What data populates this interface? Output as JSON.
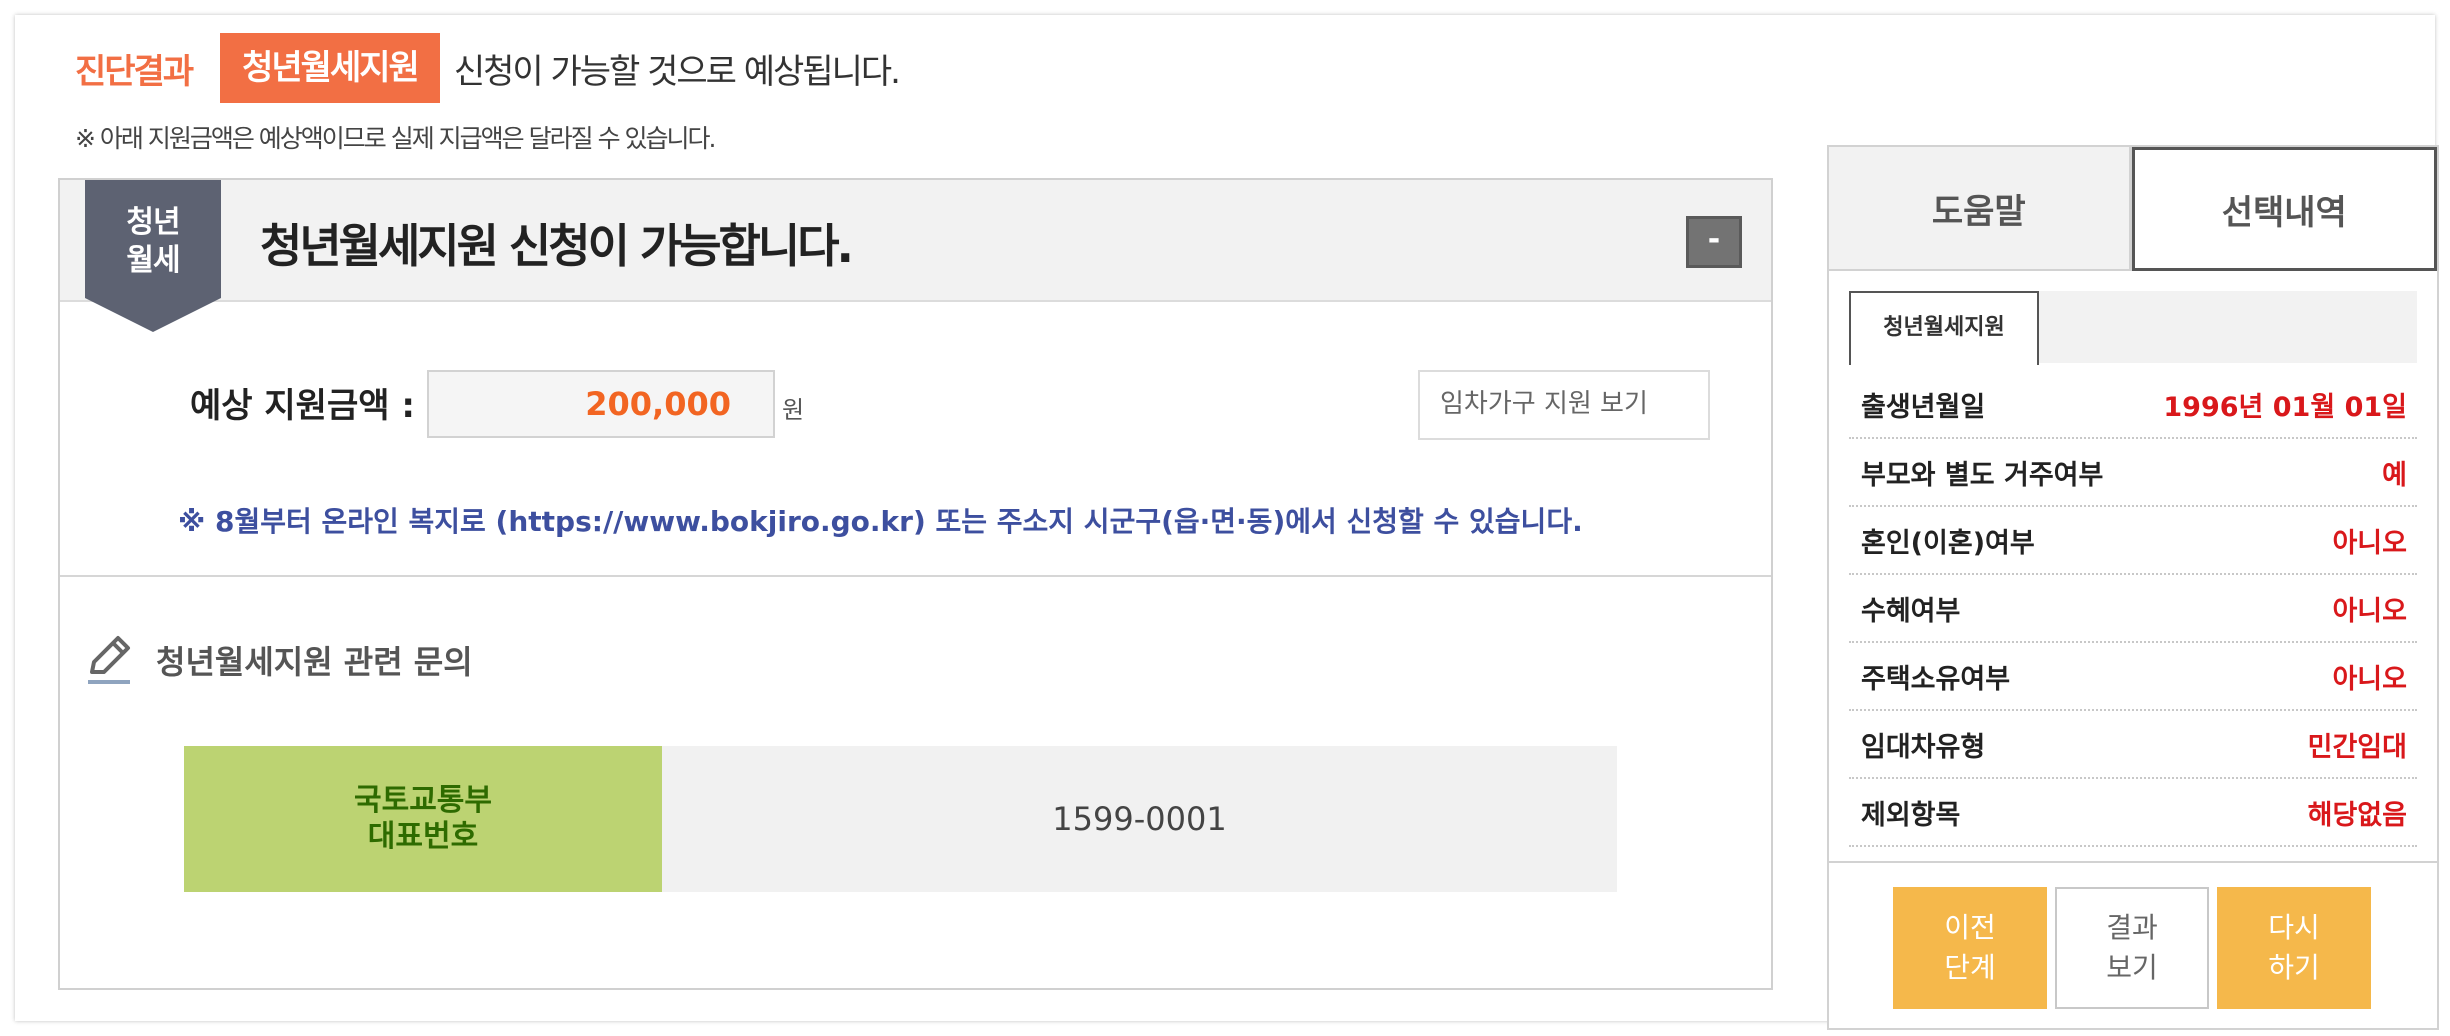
{
  "header": {
    "label": "진단결과",
    "badge": "청년월세지원",
    "text": "신청이 가능할 것으로 예상됩니다.",
    "notice": "※ 아래 지원금액은 예상액이므로 실제 지급액은 달라질 수 있습니다."
  },
  "main": {
    "ribbon_line1": "청년",
    "ribbon_line2": "월세",
    "title": "청년월세지원 신청이 가능합니다.",
    "collapse_label": "-",
    "amount_label": "예상 지원금액 :",
    "amount_value": "200,000",
    "amount_unit": "원",
    "rental_button": "임차가구 지원 보기",
    "apply_note": "※ 8월부터 온라인 복지로 (https://www.bokjiro.go.kr) 또는 주소지 시군구(읍·면·동)에서 신청할 수 있습니다.",
    "inquiry_title": "청년월세지원 관련 문의",
    "contact_label_line1": "국토교통부",
    "contact_label_line2": "대표번호",
    "contact_value": "1599-0001"
  },
  "sidebar": {
    "tabs": [
      {
        "label": "도움말"
      },
      {
        "label": "선택내역"
      }
    ],
    "active_tab": "선택내역",
    "sub_tab": "청년월세지원",
    "rows": [
      {
        "key": "출생년월일",
        "value": "1996년 01월 01일"
      },
      {
        "key": "부모와 별도 거주여부",
        "value": "예"
      },
      {
        "key": "혼인(이혼)여부",
        "value": "아니오"
      },
      {
        "key": "수혜여부",
        "value": "아니오"
      },
      {
        "key": "주택소유여부",
        "value": "아니오"
      },
      {
        "key": "임대차유형",
        "value": "민간임대"
      },
      {
        "key": "제외항목",
        "value": "해당없음"
      }
    ],
    "buttons": [
      {
        "line1": "이전",
        "line2": "단계"
      },
      {
        "line1": "결과",
        "line2": "보기"
      },
      {
        "line1": "다시",
        "line2": "하기"
      }
    ]
  },
  "colors": {
    "accent_orange": "#f26f44",
    "amount_orange": "#f26522",
    "note_blue": "#3d4f9f",
    "contact_green": "#bcd372",
    "value_red": "#d9181b",
    "button_orange": "#f5b84b",
    "ribbon_gray": "#5d6272"
  },
  "icons": {
    "inquiry": "pencil-icon"
  }
}
